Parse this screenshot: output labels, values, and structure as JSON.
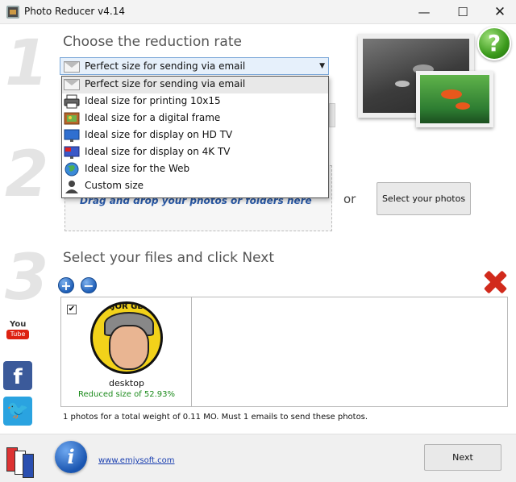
{
  "window": {
    "title": "Photo Reducer v4.14",
    "minimize": "—",
    "maximize": "☐",
    "close": "✕"
  },
  "steps": {
    "one": "1",
    "two": "2",
    "three": "3"
  },
  "section1": {
    "heading": "Choose the reduction rate",
    "selected": "Perfect size for sending via email",
    "options": [
      "Perfect size for sending via email",
      "Ideal size for printing 10x15",
      "Ideal size for a digital frame",
      "Ideal size for display on HD TV",
      "Ideal size for display on 4K TV",
      "Ideal size for the Web",
      "Custom size"
    ],
    "help": "?"
  },
  "section2": {
    "drop_text": "Drag and drop your photos or folders here",
    "or": "or",
    "select_button": "Select your photos"
  },
  "section3": {
    "heading": "Select your files and click Next",
    "add": "+",
    "remove": "−",
    "files": [
      {
        "checked": true,
        "checkmark": "✔",
        "logo_text": "MAJOR GEEKS",
        "name": "desktop",
        "reduced": "Reduced size of 52.93%"
      }
    ],
    "status": "1 photos for a total weight of 0.11 MO. Must 1 emails to send these photos."
  },
  "social": {
    "youtube_top": "You",
    "youtube_bottom": "Tube",
    "facebook": "f",
    "twitter": "🐦"
  },
  "footer": {
    "info": "i",
    "link": "www.emjysoft.com",
    "next": "Next"
  }
}
